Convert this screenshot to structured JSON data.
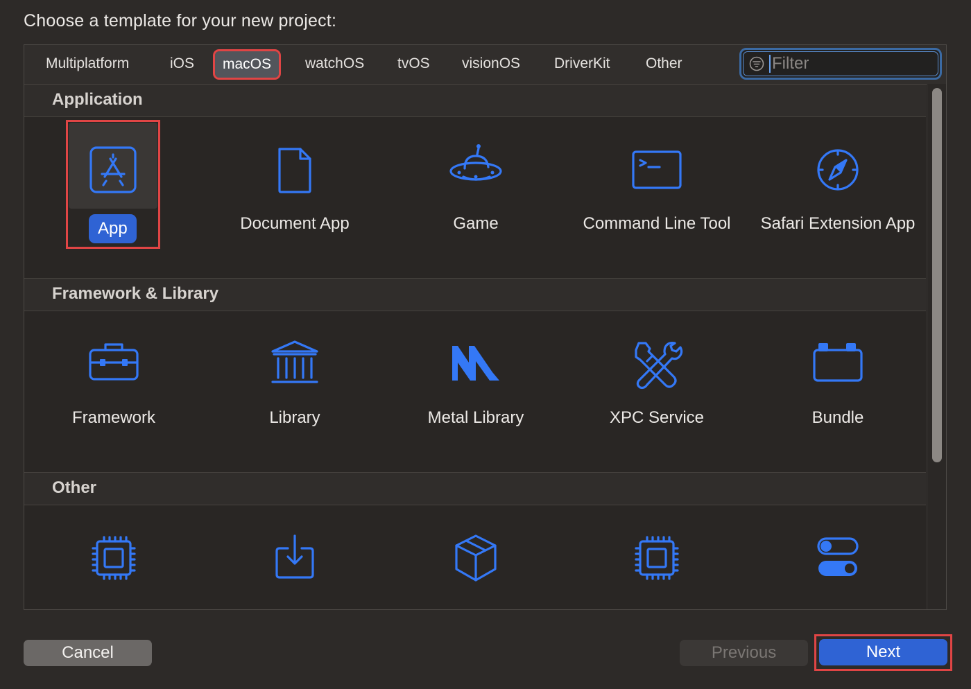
{
  "dialog": {
    "heading": "Choose a template for your new project:"
  },
  "platform_tabs": [
    {
      "label": "Multiplatform",
      "selected": false
    },
    {
      "label": "iOS",
      "selected": false
    },
    {
      "label": "macOS",
      "selected": true
    },
    {
      "label": "watchOS",
      "selected": false
    },
    {
      "label": "tvOS",
      "selected": false
    },
    {
      "label": "visionOS",
      "selected": false
    },
    {
      "label": "DriverKit",
      "selected": false
    },
    {
      "label": "Other",
      "selected": false
    }
  ],
  "filter": {
    "placeholder": "Filter",
    "value": ""
  },
  "sections": [
    {
      "title": "Application",
      "templates": [
        {
          "label": "App",
          "icon": "app-store-icon",
          "selected": true
        },
        {
          "label": "Document App",
          "icon": "document-icon",
          "selected": false
        },
        {
          "label": "Game",
          "icon": "ufo-icon",
          "selected": false
        },
        {
          "label": "Command Line Tool",
          "icon": "terminal-icon",
          "selected": false
        },
        {
          "label": "Safari Extension App",
          "icon": "compass-icon",
          "selected": false
        }
      ]
    },
    {
      "title": "Framework & Library",
      "templates": [
        {
          "label": "Framework",
          "icon": "toolbox-icon",
          "selected": false
        },
        {
          "label": "Library",
          "icon": "building-columns-icon",
          "selected": false
        },
        {
          "label": "Metal Library",
          "icon": "metal-icon",
          "selected": false
        },
        {
          "label": "XPC Service",
          "icon": "wrench-screwdriver-icon",
          "selected": false
        },
        {
          "label": "Bundle",
          "icon": "bundle-icon",
          "selected": false
        }
      ]
    },
    {
      "title": "Other",
      "templates": [
        {
          "label": "",
          "icon": "chip-icon",
          "selected": false
        },
        {
          "label": "",
          "icon": "download-tray-icon",
          "selected": false
        },
        {
          "label": "",
          "icon": "cube-icon",
          "selected": false
        },
        {
          "label": "",
          "icon": "chip-icon",
          "selected": false
        },
        {
          "label": "",
          "icon": "toggles-icon",
          "selected": false
        }
      ]
    }
  ],
  "buttons": {
    "cancel": "Cancel",
    "previous": "Previous",
    "next": "Next"
  },
  "colors": {
    "accent": "#3478f6",
    "selected_button": "#2f63d4",
    "highlight_outline": "#e04545",
    "background": "#2d2a28"
  }
}
